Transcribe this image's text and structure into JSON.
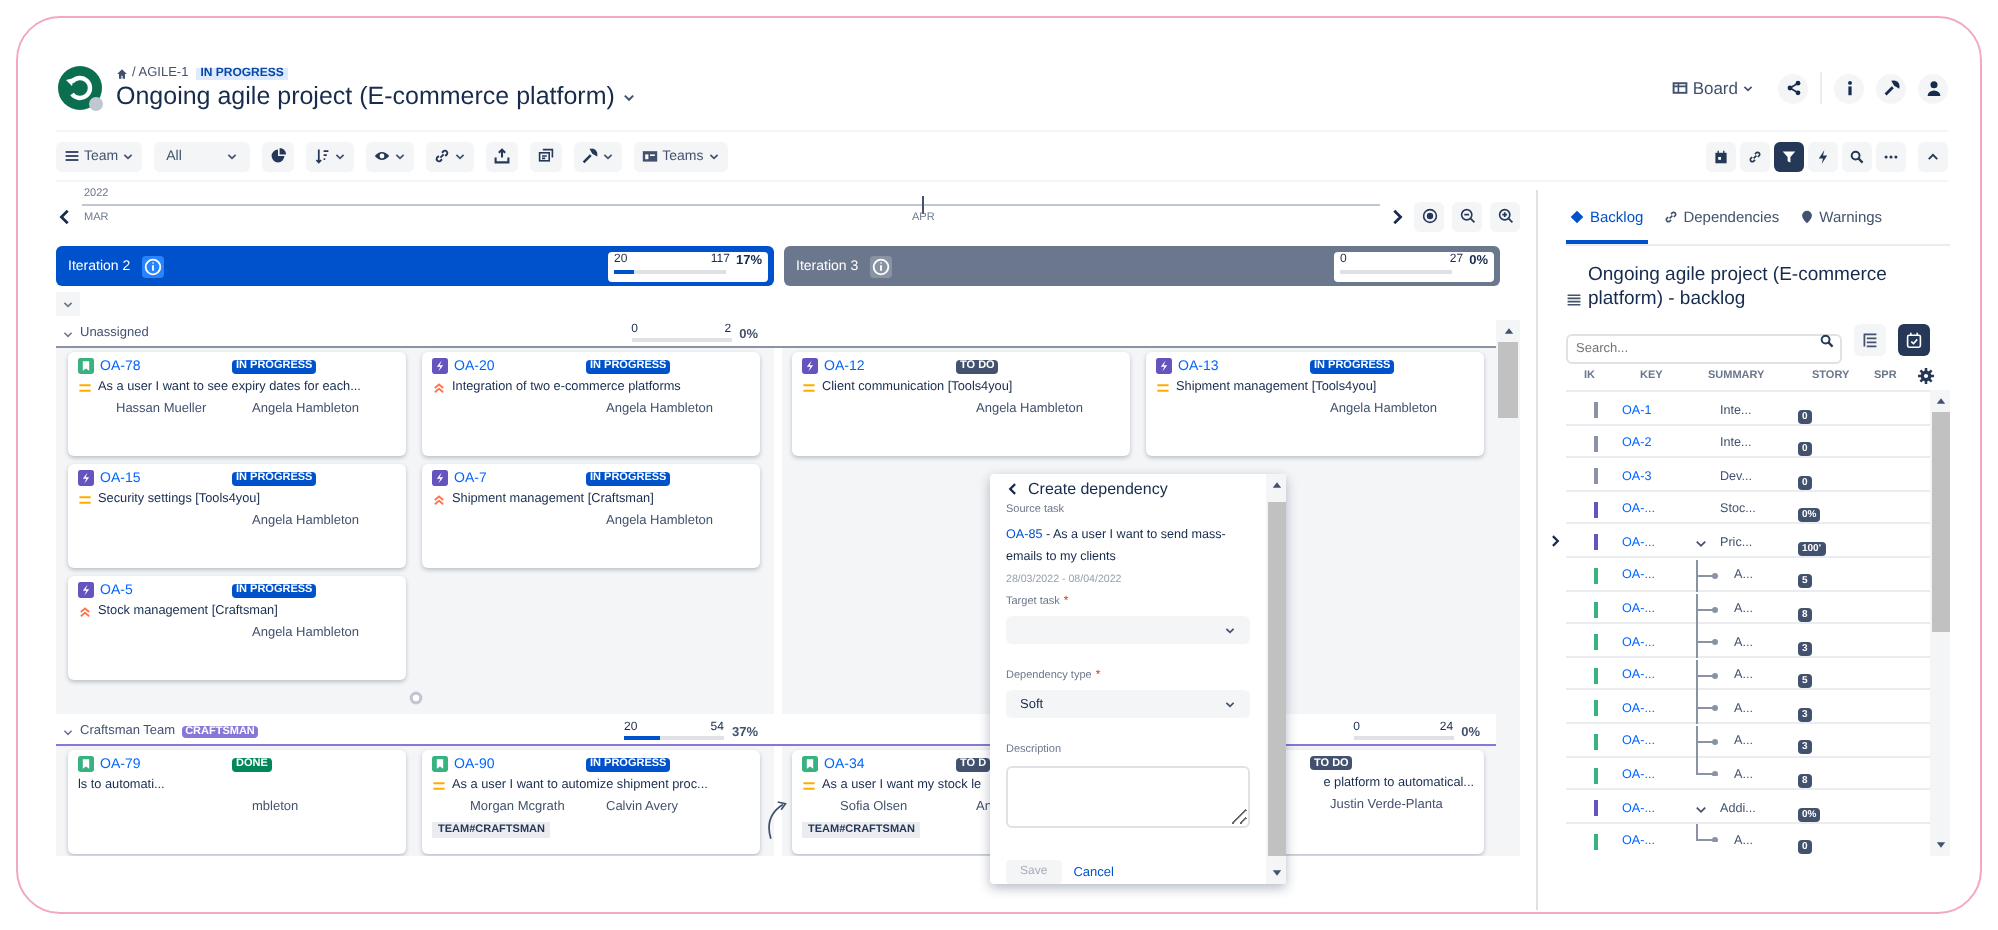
{
  "header": {
    "breadcrumb": "/ AGILE-1",
    "status": "IN PROGRESS",
    "title": "Ongoing agile project (E-commerce platform)",
    "view_button": "Board"
  },
  "toolbar": {
    "group_by": "Team",
    "filter_value": "All",
    "teams_button": "Teams"
  },
  "timeline": {
    "year": "2022",
    "months": [
      "MAR",
      "APR"
    ]
  },
  "iterations": [
    {
      "name": "Iteration 2",
      "active": true,
      "done": "20",
      "total": "117",
      "percent": "17%",
      "level": 0.17
    },
    {
      "name": "Iteration 3",
      "active": false,
      "done": "0",
      "total": "27",
      "percent": "0%",
      "level": 0
    }
  ],
  "lanes": [
    {
      "name": "Unassigned",
      "color": "#8993a4",
      "expanded": true,
      "cells": [
        {
          "progress": {
            "done": "0",
            "total": "2",
            "percent": "0%",
            "level": 0
          },
          "add_button": true,
          "cards": [
            {
              "key": "OA-78",
              "kind": "story",
              "status": "IN PROGRESS",
              "color": "#0052cc",
              "high_priority": false,
              "summary": "As a user I want to see expiry dates for each...",
              "assignees": [
                "Hassan Mueller",
                "Angela Hambleton"
              ]
            },
            {
              "key": "OA-20",
              "kind": "epic",
              "status": "IN PROGRESS",
              "color": "#0052cc",
              "high_priority": true,
              "summary": "Integration of two e-commerce platforms",
              "assignees": [
                "Angela Hambleton"
              ]
            },
            {
              "key": "OA-15",
              "kind": "epic",
              "status": "IN PROGRESS",
              "color": "#0052cc",
              "high_priority": false,
              "summary": "Security settings [Tools4you]",
              "assignees": [
                "Angela Hambleton"
              ]
            },
            {
              "key": "OA-7",
              "kind": "epic",
              "status": "IN PROGRESS",
              "color": "#0052cc",
              "high_priority": true,
              "summary": "Shipment management [Craftsman]",
              "assignees": [
                "Angela Hambleton"
              ]
            },
            {
              "key": "OA-5",
              "kind": "epic",
              "status": "IN PROGRESS",
              "color": "#0052cc",
              "high_priority": true,
              "summary": "Stock management [Craftsman]",
              "assignees": [
                "Angela Hambleton"
              ]
            }
          ]
        },
        {
          "cards": [
            {
              "key": "OA-12",
              "kind": "epic",
              "status": "TO DO",
              "color": "#42526e",
              "high_priority": false,
              "summary": "Client communication [Tools4you]",
              "assignees": [
                "Angela Hambleton"
              ]
            },
            {
              "key": "OA-13",
              "kind": "epic",
              "status": "IN PROGRESS",
              "color": "#0052cc",
              "high_priority": false,
              "summary": "Shipment management [Tools4you]",
              "assignees": [
                "Angela Hambleton"
              ]
            }
          ]
        }
      ]
    },
    {
      "name": "Craftsman Team",
      "tag": "CRAFTSMAN",
      "color": "#8777d9",
      "expanded": true,
      "dependency_arrow": true,
      "cells": [
        {
          "progress": {
            "done": "20",
            "total": "54",
            "percent": "37%",
            "level": 0.37
          },
          "cards": [
            {
              "key": "OA-79",
              "kind": "story",
              "status": "DONE",
              "color": "#00875a",
              "summary": "ls to automati...",
              "assignees": [
                "mbleton"
              ]
            },
            {
              "key": "OA-90",
              "kind": "story",
              "status": "IN PROGRESS",
              "color": "#0052cc",
              "high_priority": false,
              "summary": "As a user I want to automize shipment proc...",
              "assignees": [
                "Morgan Mcgrath",
                "Calvin Avery"
              ],
              "team": "TEAM#CRAFTSMAN"
            }
          ]
        },
        {
          "progress": {
            "done": "0",
            "total": "24",
            "percent": "0%",
            "level": 0
          },
          "cards": [
            {
              "key": "OA-34",
              "kind": "story",
              "status": "TO D",
              "color": "#42526e",
              "high_priority": false,
              "summary": "As a user I want my stock le",
              "assignees": [
                "Sofia Olsen",
                "An"
              ],
              "team": "TEAM#CRAFTSMAN"
            },
            {
              "status": "TO DO",
              "color": "#42526e",
              "summary": "e platform to automatical...",
              "assignees": [
                "Justin Verde-Planta"
              ]
            }
          ]
        }
      ]
    }
  ],
  "dependency_popup": {
    "title": "Create dependency",
    "source_label": "Source task",
    "source_key": "OA-85",
    "source_text": " - As a user I want to send mass-emails to my clients",
    "dates": "28/03/2022 - 08/04/2022",
    "target_label": "Target task",
    "required_mark": "*",
    "type_label": "Dependency type",
    "type_value": "Soft",
    "description_label": "Description",
    "save_button": "Save",
    "save_disabled": true,
    "cancel_button": "Cancel"
  },
  "panel": {
    "tabs": [
      {
        "label": "Backlog",
        "selected": true
      },
      {
        "label": "Dependencies",
        "selected": false
      },
      {
        "label": "Warnings",
        "selected": false
      }
    ],
    "title": "Ongoing agile project (E-commerce platform) - backlog",
    "search": {
      "placeholder": "Search..."
    },
    "columns": [
      "IK",
      "KEY",
      "SUMMARY",
      "STORY",
      "SPR"
    ],
    "rows": [
      {
        "key": "OA-1",
        "summary": "Inte...",
        "story": "0",
        "color": "#8993a4"
      },
      {
        "key": "OA-2",
        "summary": "Inte...",
        "story": "0",
        "color": "#8993a4"
      },
      {
        "key": "OA-3",
        "summary": "Dev...",
        "story": "0",
        "color": "#8993a4"
      },
      {
        "key": "OA-...",
        "summary": "Stoc...",
        "story": "0%",
        "color": "#6554c0"
      },
      {
        "key": "OA-...",
        "summary": "Pric...",
        "story": "100'",
        "color": "#6554c0",
        "expanded": true,
        "children": [
          {
            "key": "OA-...",
            "summary": "A...",
            "story": "5",
            "color": "#36b37e"
          },
          {
            "key": "OA-...",
            "summary": "A...",
            "story": "8",
            "color": "#36b37e"
          },
          {
            "key": "OA-...",
            "summary": "A...",
            "story": "3",
            "color": "#36b37e"
          },
          {
            "key": "OA-...",
            "summary": "A...",
            "story": "5",
            "color": "#36b37e"
          },
          {
            "key": "OA-...",
            "summary": "A...",
            "story": "3",
            "color": "#36b37e"
          },
          {
            "key": "OA-...",
            "summary": "A...",
            "story": "3",
            "color": "#36b37e"
          },
          {
            "key": "OA-...",
            "summary": "A...",
            "story": "8",
            "color": "#36b37e"
          }
        ]
      },
      {
        "key": "OA-...",
        "summary": "Addi...",
        "story": "0%",
        "color": "#6554c0",
        "expanded": true,
        "children": [
          {
            "key": "OA-...",
            "summary": "A...",
            "story": "0",
            "color": "#36b37e"
          }
        ]
      }
    ]
  }
}
